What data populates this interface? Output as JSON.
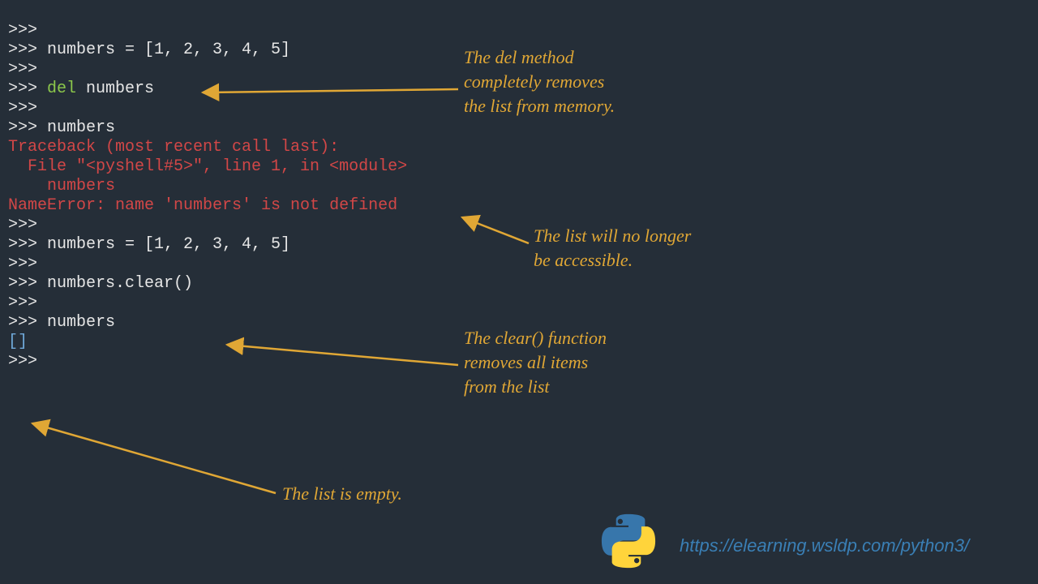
{
  "terminal": {
    "l1": ">>>",
    "l2a": ">>> numbers = [1, 2, 3, 4, 5]",
    "l3": ">>>",
    "l4a": ">>> ",
    "l4b": "del",
    "l4c": " numbers",
    "l5": ">>>",
    "l6": ">>> numbers",
    "e1": "Traceback (most recent call last):",
    "e2": "  File \"<pyshell#5>\", line 1, in <module>",
    "e3": "    numbers",
    "e4": "NameError: name 'numbers' is not defined",
    "l7": ">>>",
    "l8": ">>> numbers = [1, 2, 3, 4, 5]",
    "l9": ">>>",
    "l10": ">>> numbers.clear()",
    "l11": ">>>",
    "l12": ">>> numbers",
    "out": "[]",
    "l13": ">>>"
  },
  "annotations": {
    "a1": "The del method\ncompletely removes\nthe list from memory.",
    "a2": "The list will no longer\nbe accessible.",
    "a3": "The clear() function\nremoves all items\nfrom the list",
    "a4": "The list is empty."
  },
  "url": "https://elearning.wsldp.com/python3/",
  "colors": {
    "bg": "#252e38",
    "text": "#e6e6e6",
    "keyword": "#8cc84b",
    "error": "#d24747",
    "output": "#6fa8d8",
    "annotation": "#e0a735",
    "link": "#3a7fb5"
  }
}
